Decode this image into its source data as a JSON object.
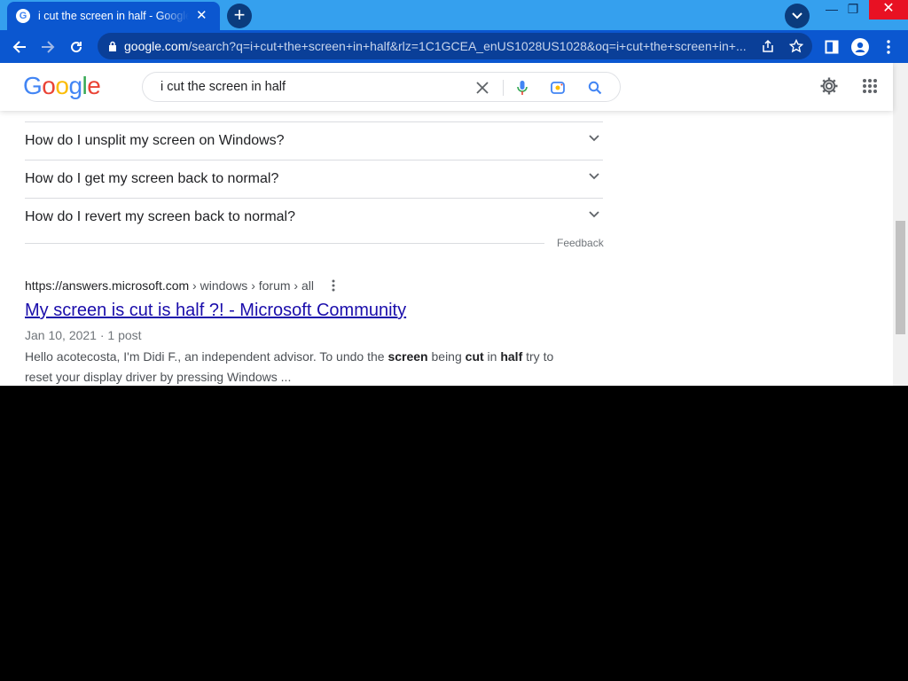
{
  "browser": {
    "tab_title": "i cut the screen in half - Google Search",
    "new_tab_label": "+",
    "omnibox": {
      "domain": "google.com",
      "path": "/search?q=i+cut+the+screen+in+half&rlz=1C1GCEA_enUS1028US1028&oq=i+cut+the+screen+in+..."
    }
  },
  "header": {
    "logo": "Google",
    "search_query": "i cut the screen in half"
  },
  "questions": [
    "How do I unsplit my screen on Windows?",
    "How do I get my screen back to normal?",
    "How do I revert my screen back to normal?"
  ],
  "feedback_label": "Feedback",
  "result": {
    "site": "https://answers.microsoft.com",
    "breadcrumb": " › windows › forum › all",
    "title": "My screen is cut is half ?! - Microsoft Community",
    "date": "Jan 10, 2021",
    "posts": "1 post",
    "snippet": [
      {
        "t": "Hello acotecosta, I'm Didi F., an independent advisor. To undo the ",
        "b": false
      },
      {
        "t": "screen",
        "b": true
      },
      {
        "t": " being ",
        "b": false
      },
      {
        "t": "cut",
        "b": true
      },
      {
        "t": " in ",
        "b": false
      },
      {
        "t": "half",
        "b": true
      },
      {
        "t": " try to reset your display driver by pressing Windows ...",
        "b": false
      }
    ]
  },
  "colors": {
    "tab_strip": "#35a0ee",
    "toolbar": "#0b57d0",
    "link": "#1a0dab"
  }
}
